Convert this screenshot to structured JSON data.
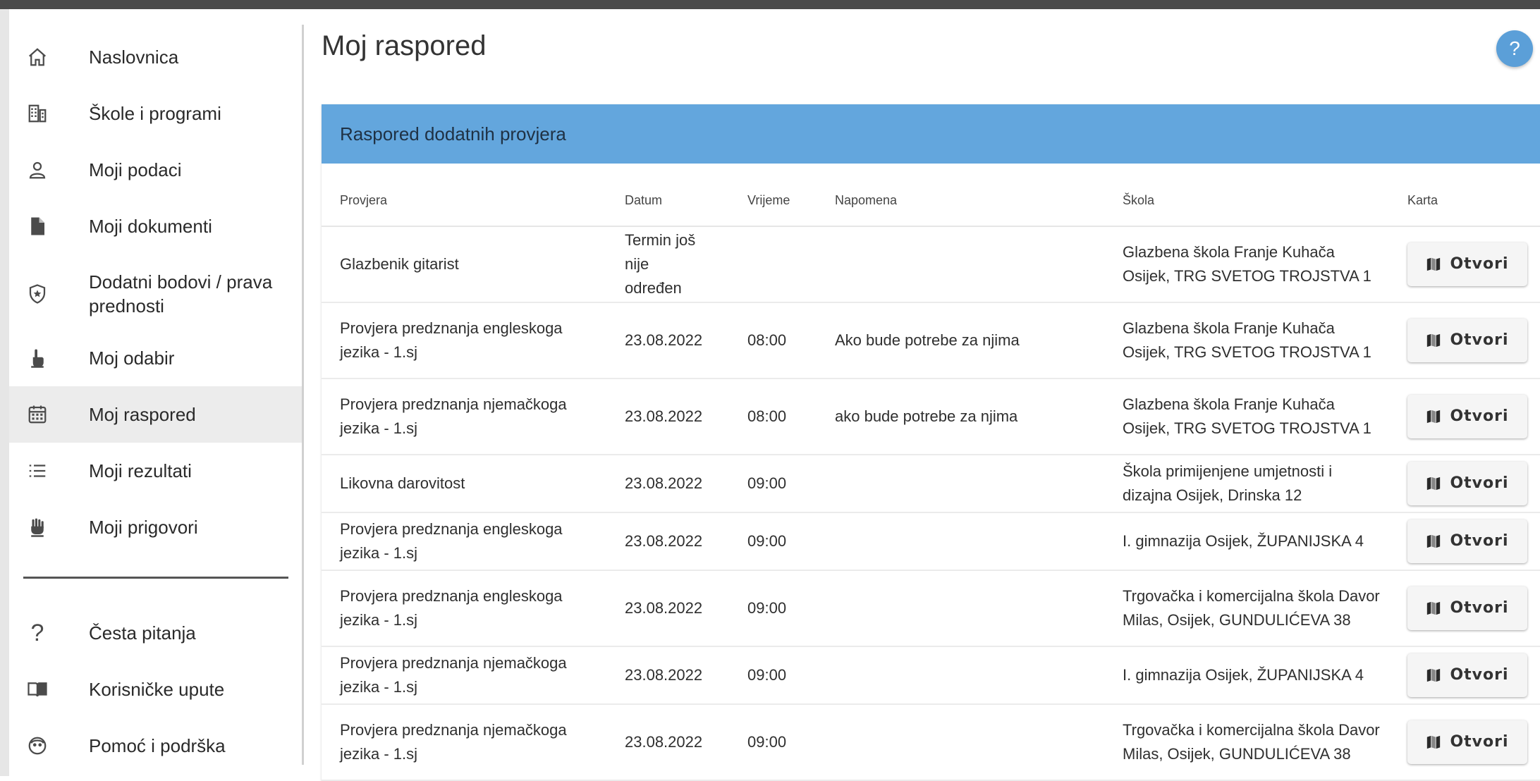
{
  "sidebar": {
    "items": [
      {
        "label": "Naslovnica",
        "icon": "home-icon"
      },
      {
        "label": "Škole i programi",
        "icon": "building-icon"
      },
      {
        "label": "Moji podaci",
        "icon": "user-icon"
      },
      {
        "label": "Moji dokumenti",
        "icon": "document-icon"
      },
      {
        "label": "Dodatni bodovi / prava prednosti",
        "icon": "shield-star-icon"
      },
      {
        "label": "Moj odabir",
        "icon": "hand-pointer-icon"
      },
      {
        "label": "Moj raspored",
        "icon": "calendar-icon",
        "active": true
      },
      {
        "label": "Moji rezultati",
        "icon": "list-icon"
      },
      {
        "label": "Moji prigovori",
        "icon": "raised-hand-icon"
      }
    ],
    "bottom_items": [
      {
        "label": "Česta pitanja",
        "icon": "question-icon"
      },
      {
        "label": "Korisničke upute",
        "icon": "book-icon"
      },
      {
        "label": "Pomoć i podrška",
        "icon": "support-icon"
      }
    ]
  },
  "main": {
    "title": "Moj raspored",
    "help_label": "?",
    "card_title": "Raspored dodatnih provjera",
    "columns": [
      "Provjera",
      "Datum",
      "Vrijeme",
      "Napomena",
      "Škola",
      "Karta"
    ],
    "rows": [
      {
        "provjera": "Glazbenik gitarist",
        "datum": "Termin još nije određen",
        "vrijeme": "",
        "napomena": "",
        "skola": "Glazbena škola Franje Kuhača Osijek, TRG SVETOG TROJSTVA 1",
        "karta": "Otvori"
      },
      {
        "provjera": "Provjera predznanja engleskoga jezika - 1.sj",
        "datum": "23.08.2022",
        "vrijeme": "08:00",
        "napomena": "Ako bude potrebe za njima",
        "skola": "Glazbena škola Franje Kuhača Osijek, TRG SVETOG TROJSTVA 1",
        "karta": "Otvori"
      },
      {
        "provjera": "Provjera predznanja njemačkoga jezika - 1.sj",
        "datum": "23.08.2022",
        "vrijeme": "08:00",
        "napomena": "ako bude potrebe za njima",
        "skola": "Glazbena škola Franje Kuhača Osijek, TRG SVETOG TROJSTVA 1",
        "karta": "Otvori"
      },
      {
        "provjera": "Likovna darovitost",
        "datum": "23.08.2022",
        "vrijeme": "09:00",
        "napomena": "",
        "skola": "Škola primijenjene umjetnosti i dizajna Osijek, Drinska 12",
        "karta": "Otvori"
      },
      {
        "provjera": "Provjera predznanja engleskoga jezika - 1.sj",
        "datum": "23.08.2022",
        "vrijeme": "09:00",
        "napomena": "",
        "skola": "I. gimnazija Osijek, ŽUPANIJSKA 4",
        "karta": "Otvori"
      },
      {
        "provjera": "Provjera predznanja engleskoga jezika - 1.sj",
        "datum": "23.08.2022",
        "vrijeme": "09:00",
        "napomena": "",
        "skola": "Trgovačka i komercijalna škola Davor Milas, Osijek, GUNDULIĆEVA 38",
        "karta": "Otvori"
      },
      {
        "provjera": "Provjera predznanja njemačkoga jezika - 1.sj",
        "datum": "23.08.2022",
        "vrijeme": "09:00",
        "napomena": "",
        "skola": "I. gimnazija Osijek, ŽUPANIJSKA 4",
        "karta": "Otvori"
      },
      {
        "provjera": "Provjera predznanja njemačkoga jezika - 1.sj",
        "datum": "23.08.2022",
        "vrijeme": "09:00",
        "napomena": "",
        "skola": "Trgovačka i komercijalna škola Davor Milas, Osijek, GUNDULIĆEVA 38",
        "karta": "Otvori"
      }
    ]
  }
}
